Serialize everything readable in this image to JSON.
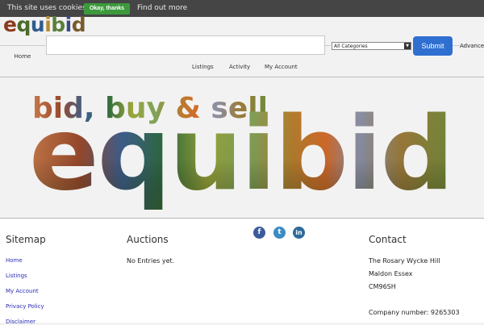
{
  "cookie_bar": {
    "message": "This site uses cookies",
    "ok_label": "Okay, thanks",
    "more_label": "Find out more"
  },
  "logo": {
    "letters": [
      "e",
      "q",
      "u",
      "i",
      "b",
      "i",
      "d"
    ]
  },
  "nav": {
    "home": "Home",
    "items": [
      "Listings",
      "Activity",
      "My Account"
    ]
  },
  "search": {
    "value": "",
    "category_selected": "All Categories",
    "submit_label": "Submit",
    "advanced_label": "Advanced"
  },
  "hero": {
    "tagline": "bid, buy & sell",
    "wordmark": "equibid"
  },
  "footer": {
    "sitemap": {
      "heading": "Sitemap",
      "links": [
        "Home",
        "Listings",
        "My Account",
        "Privacy Policy",
        "Disclaimer"
      ]
    },
    "auctions": {
      "heading": "Auctions",
      "empty_text": "No Entries yet."
    },
    "social": [
      "facebook-icon",
      "twitter-icon",
      "linkedin-icon"
    ],
    "contact": {
      "heading": "Contact",
      "address_line1": "The Rosary Wycke Hill",
      "address_line2": "Maldon Essex",
      "postcode": "CM96SH",
      "company_number": "Company number: 9265303"
    }
  },
  "colors": {
    "cookie_bar_bg": "#454545",
    "cookie_ok_bg": "#3c9a3c",
    "submit_bg": "#2f6fd0",
    "link": "#2b2bb5"
  }
}
